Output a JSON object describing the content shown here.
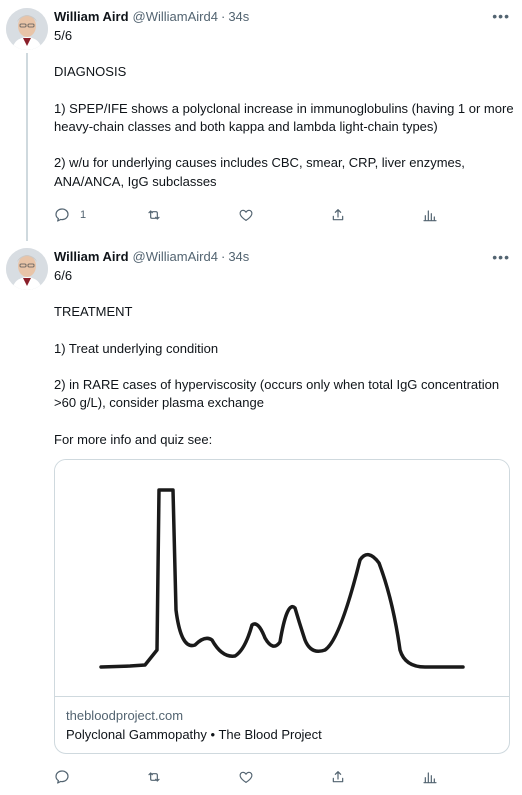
{
  "tweets": [
    {
      "author": "William Aird",
      "handle": "@WilliamAird4",
      "time": "34s",
      "text": "5/6\n\nDIAGNOSIS\n\n1) SPEP/IFE shows a polyclonal increase in immunoglobulins (having 1 or more heavy-chain classes and both kappa and lambda light-chain types)\n\n2) w/u for underlying causes includes CBC, smear, CRP, liver enzymes, ANA/ANCA, IgG subclasses",
      "reply_count": "1"
    },
    {
      "author": "William Aird",
      "handle": "@WilliamAird4",
      "time": "34s",
      "text": "6/6\n\nTREATMENT\n\n1) Treat underlying condition\n\n2) in RARE cases of hyperviscosity (occurs only when total IgG concentration >60 g/L), consider plasma exchange\n\nFor more info and quiz see:",
      "card": {
        "domain": "thebloodproject.com",
        "title": "Polyclonal Gammopathy • The Blood Project"
      }
    }
  ],
  "icons": {
    "more": "more-horizontal-icon",
    "reply": "reply-icon",
    "retweet": "retweet-icon",
    "like": "heart-icon",
    "share": "share-icon",
    "analytics": "analytics-icon"
  },
  "colors": {
    "text": "#0f1419",
    "secondary": "#536471",
    "border": "#cfd9de"
  }
}
